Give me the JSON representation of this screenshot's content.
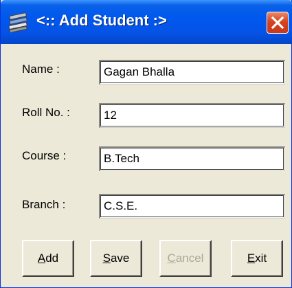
{
  "window": {
    "title": "<:: Add Student :>",
    "app_icon": "stacked-books-icon",
    "close_icon": "close-icon"
  },
  "fields": [
    {
      "label": "Name :",
      "value": "Gagan Bhalla"
    },
    {
      "label": "Roll No. :",
      "value": "12"
    },
    {
      "label": "Course :",
      "value": "B.Tech"
    },
    {
      "label": "Branch :",
      "value": "C.S.E."
    }
  ],
  "buttons": {
    "add": {
      "label_mnemonic": "A",
      "label_rest": "dd",
      "enabled": true
    },
    "save": {
      "label_mnemonic": "S",
      "label_rest": "ave",
      "enabled": true
    },
    "cancel": {
      "label_mnemonic": "C",
      "label_rest": "ancel",
      "enabled": false
    },
    "exit": {
      "label_mnemonic": "E",
      "label_rest": "xit",
      "enabled": true
    }
  },
  "colors": {
    "titlebar": "#0553e6",
    "face": "#ece9d8",
    "close": "#d8431e",
    "disabled_text": "#aca899"
  }
}
